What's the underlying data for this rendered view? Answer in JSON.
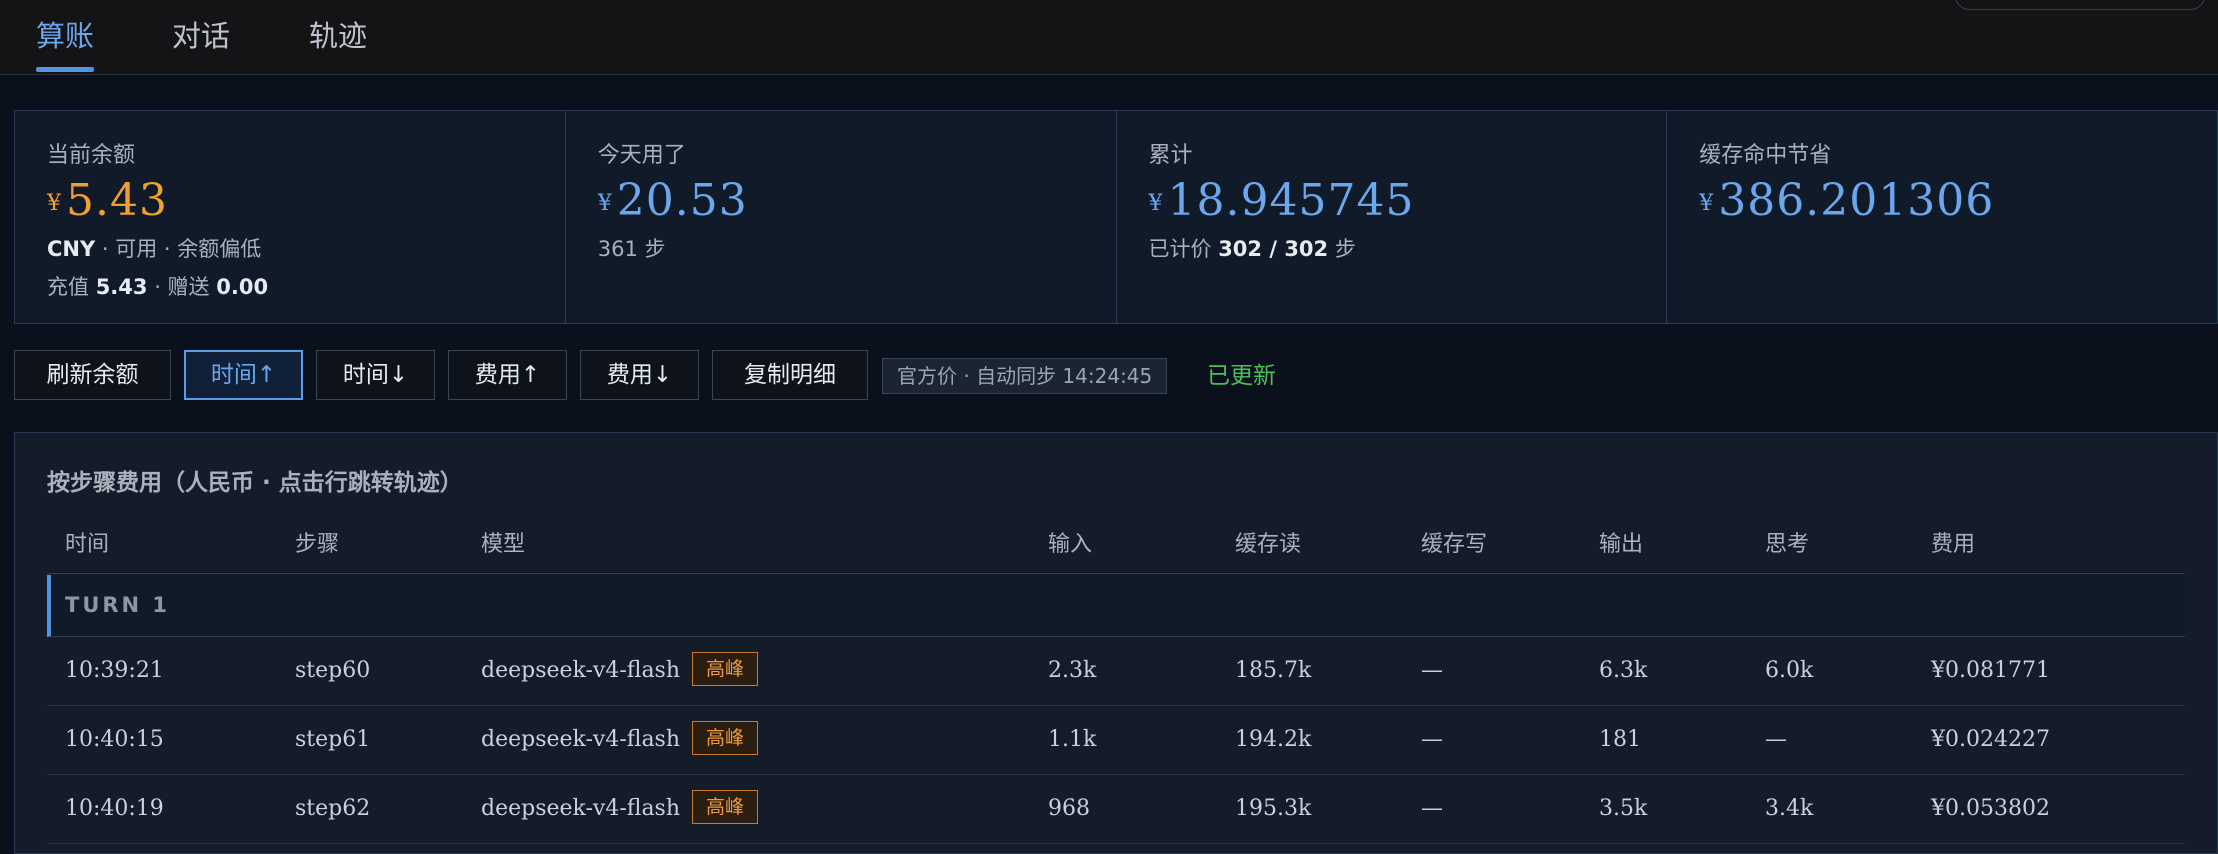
{
  "tabs": [
    {
      "label": "算账",
      "active": true
    },
    {
      "label": "对话",
      "active": false
    },
    {
      "label": "轨迹",
      "active": false
    }
  ],
  "stats": {
    "balance": {
      "label": "当前余额",
      "currency_symbol": "¥",
      "value": "5.43",
      "status_line": "· 可用 · 余额偏低",
      "currency_code": "CNY",
      "recharge_label": "充值",
      "recharge_value": "5.43",
      "gift_label": "· 赠送",
      "gift_value": "0.00"
    },
    "today": {
      "label": "今天用了",
      "currency_symbol": "¥",
      "value": "20.53",
      "steps": "361 步"
    },
    "total": {
      "label": "累计",
      "currency_symbol": "¥",
      "value": "18.945745",
      "priced_label": "已计价",
      "priced_value": "302 / 302",
      "priced_unit": "步"
    },
    "cache": {
      "label": "缓存命中节省",
      "currency_symbol": "¥",
      "value": "386.201306"
    }
  },
  "toolbar": {
    "refresh": "刷新余额",
    "time_asc": "时间↑",
    "time_desc": "时间↓",
    "cost_asc": "费用↑",
    "cost_desc": "费用↓",
    "copy": "复制明细",
    "price_badge": "官方价 · 自动同步 14:24:45",
    "updated": "已更新"
  },
  "table": {
    "title": "按步骤费用（人民币 · 点击行跳转轨迹）",
    "columns": [
      "时间",
      "步骤",
      "模型",
      "输入",
      "缓存读",
      "缓存写",
      "输出",
      "思考",
      "费用"
    ],
    "turn_label": "TURN 1",
    "rows": [
      {
        "time": "10:39:21",
        "step": "step60",
        "model": "deepseek-v4-flash",
        "tag": "高峰",
        "input": "2.3k",
        "cache_read": "185.7k",
        "cache_write": "—",
        "output": "6.3k",
        "thinking": "6.0k",
        "cost": "¥0.081771"
      },
      {
        "time": "10:40:15",
        "step": "step61",
        "model": "deepseek-v4-flash",
        "tag": "高峰",
        "input": "1.1k",
        "cache_read": "194.2k",
        "cache_write": "—",
        "output": "181",
        "thinking": "—",
        "cost": "¥0.024227"
      },
      {
        "time": "10:40:19",
        "step": "step62",
        "model": "deepseek-v4-flash",
        "tag": "高峰",
        "input": "968",
        "cache_read": "195.3k",
        "cache_write": "—",
        "output": "3.5k",
        "thinking": "3.4k",
        "cost": "¥0.053802"
      }
    ]
  }
}
